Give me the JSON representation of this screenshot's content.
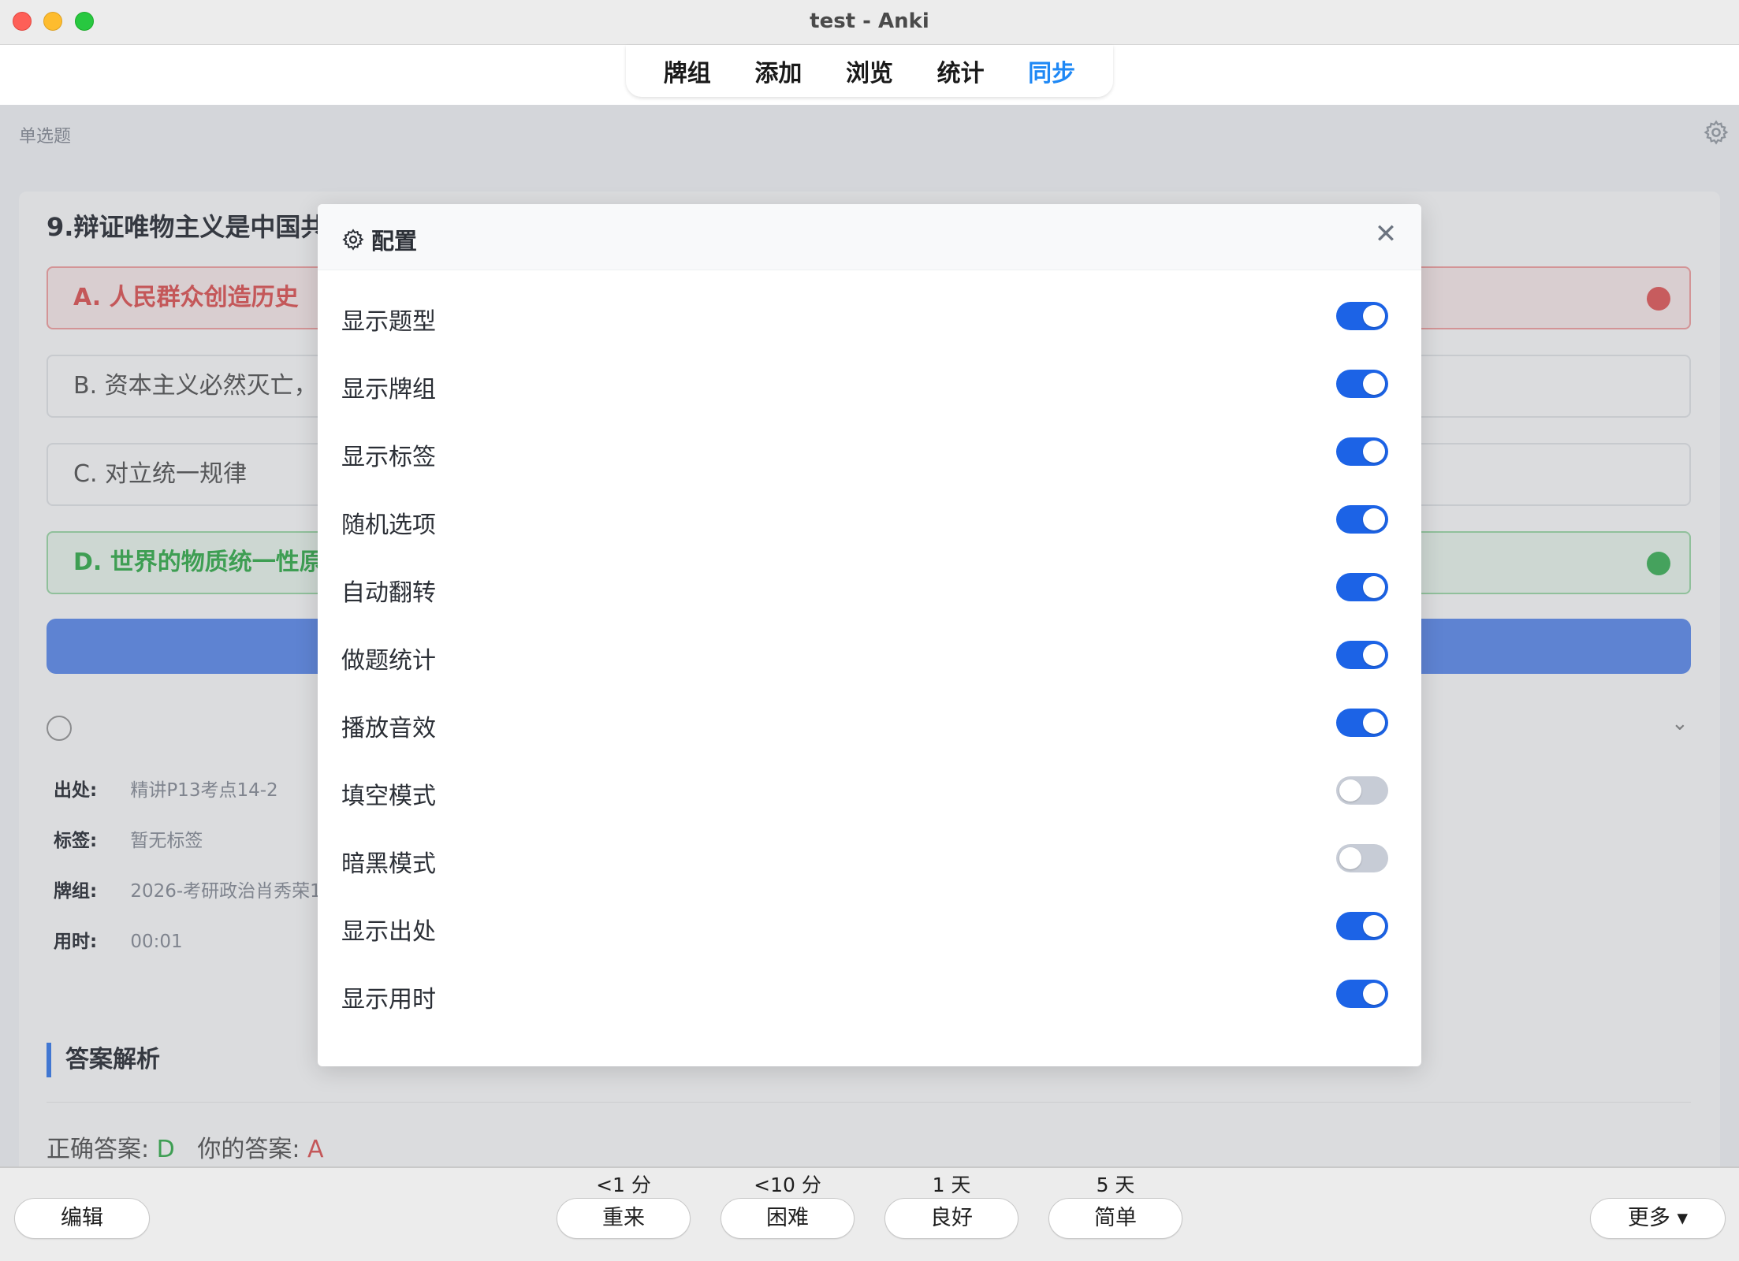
{
  "window": {
    "title": "test - Anki"
  },
  "tabs": [
    {
      "label": "牌组"
    },
    {
      "label": "添加"
    },
    {
      "label": "浏览"
    },
    {
      "label": "统计"
    },
    {
      "label": "同步"
    }
  ],
  "review": {
    "question_type": "单选题",
    "question": "9.辩证唯物主义是中国共",
    "options": [
      {
        "text": "A. 人民群众创造历史"
      },
      {
        "text": "B. 资本主义必然灭亡，"
      },
      {
        "text": "C. 对立统一规律"
      },
      {
        "text": "D. 世界的物质统一性原"
      }
    ],
    "meta": [
      {
        "label": "出处:",
        "value": "精讲P13考点14-2"
      },
      {
        "label": "标签:",
        "value": "暂无标签"
      },
      {
        "label": "牌组:",
        "value": "2026-考研政治肖秀荣1"
      },
      {
        "label": "用时:",
        "value": "00:01"
      }
    ],
    "analysis_title": "答案解析",
    "correct_label": "正确答案:",
    "correct_value": "D",
    "your_label": "你的答案:",
    "your_value": "A"
  },
  "dialog": {
    "title": "配置",
    "settings": [
      {
        "label": "显示题型",
        "on": true
      },
      {
        "label": "显示牌组",
        "on": true
      },
      {
        "label": "显示标签",
        "on": true
      },
      {
        "label": "随机选项",
        "on": true
      },
      {
        "label": "自动翻转",
        "on": true
      },
      {
        "label": "做题统计",
        "on": true
      },
      {
        "label": "播放音效",
        "on": true
      },
      {
        "label": "填空模式",
        "on": false
      },
      {
        "label": "暗黑模式",
        "on": false
      },
      {
        "label": "显示出处",
        "on": true
      },
      {
        "label": "显示用时",
        "on": true
      }
    ]
  },
  "bottom": {
    "edit_label": "编辑",
    "more_label": "更多 ▾",
    "ease": [
      {
        "time": "<1 分",
        "label": "重来"
      },
      {
        "time": "<10 分",
        "label": "困难"
      },
      {
        "time": "1 天",
        "label": "良好"
      },
      {
        "time": "5 天",
        "label": "简单"
      }
    ]
  },
  "colors": {
    "accent": "#1c63e6",
    "active_tab": "#1e88f5"
  }
}
